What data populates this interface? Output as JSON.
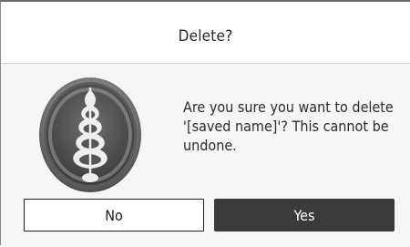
{
  "dialog": {
    "title": "Delete?",
    "message": "Are you sure you want to delete '[saved name]'? This cannot be undone.",
    "image": "latte-art-icon",
    "buttons": {
      "no_label": "No",
      "yes_label": "Yes"
    }
  },
  "colors": {
    "primary_button": "#3a3a3a",
    "background": "#f6f6f6",
    "header": "#ffffff"
  }
}
